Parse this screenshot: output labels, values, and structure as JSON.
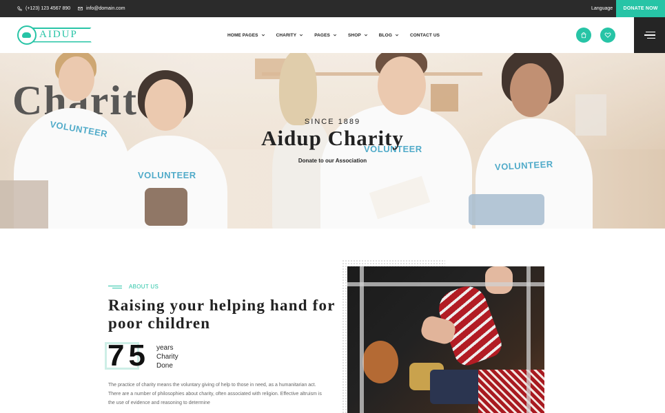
{
  "topbar": {
    "phone": "(+123) 123 4567 890",
    "email": "info@domain.com",
    "language": "Language",
    "donate": "DONATE NOW"
  },
  "header": {
    "logo_text": "AIDUP",
    "nav": [
      {
        "label": "HOME PAGES",
        "dropdown": true
      },
      {
        "label": "CHARITY",
        "dropdown": true
      },
      {
        "label": "PAGES",
        "dropdown": true
      },
      {
        "label": "SHOP",
        "dropdown": true
      },
      {
        "label": "BLOG",
        "dropdown": true
      },
      {
        "label": "CONTACT US",
        "dropdown": false
      }
    ],
    "icons": [
      "shopping-bag-icon",
      "heart-icon",
      "hamburger-menu-icon"
    ]
  },
  "hero": {
    "since": "SINCE 1889",
    "title": "Aidup Charity",
    "subtitle": "Donate to our Association",
    "shirt_text": "VOLUNTEER",
    "wall_letters": "Charit"
  },
  "about": {
    "label": "ABOUT US",
    "heading": "Raising your helping hand for poor children",
    "counter": "75",
    "counter_label_1": "years",
    "counter_label_2": "Charity",
    "counter_label_3": "Done",
    "text": "The practice of charity means the voluntary giving of help to those in need, as a humanitarian act. There are a number of philosophies about charity, often associated with religion. Effective altruism is the use of evidence and reasoning to determine"
  },
  "colors": {
    "accent": "#27c4a6",
    "dark": "#2b2b2b"
  }
}
